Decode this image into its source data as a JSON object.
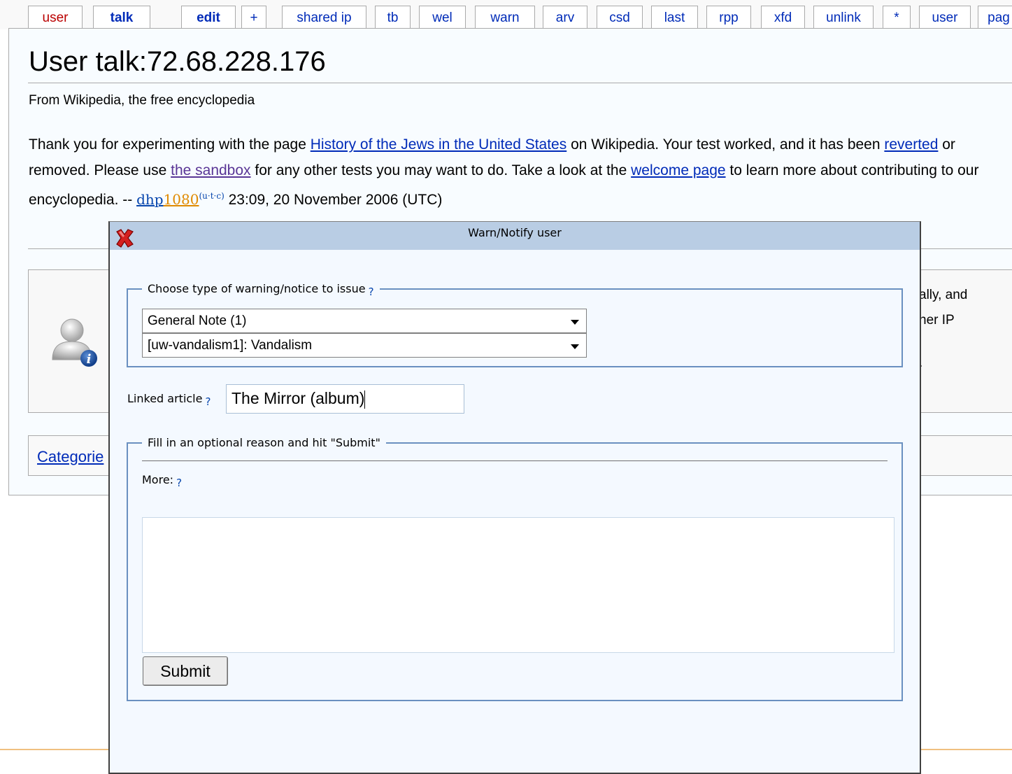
{
  "tabs": [
    {
      "label": "user",
      "style": "red"
    },
    {
      "label": "talk",
      "style": "active"
    },
    {
      "label": "edit",
      "style": "bold"
    },
    {
      "label": "+",
      "style": "normal"
    },
    {
      "label": "shared ip",
      "style": "normal"
    },
    {
      "label": "tb",
      "style": "normal"
    },
    {
      "label": "wel",
      "style": "normal"
    },
    {
      "label": "warn",
      "style": "normal"
    },
    {
      "label": "arv",
      "style": "normal"
    },
    {
      "label": "csd",
      "style": "normal"
    },
    {
      "label": "last",
      "style": "normal"
    },
    {
      "label": "rpp",
      "style": "normal"
    },
    {
      "label": "xfd",
      "style": "normal"
    },
    {
      "label": "unlink",
      "style": "normal"
    },
    {
      "label": "*",
      "style": "normal"
    },
    {
      "label": "user",
      "style": "normal"
    },
    {
      "label": "pag",
      "style": "normal"
    }
  ],
  "page": {
    "title": "User talk:72.68.228.176",
    "subtitle": "From Wikipedia, the free encyclopedia",
    "para_1": "Thank you for experimenting with the page ",
    "link_history": "History of the Jews in the United States",
    "para_2": " on Wikipedia. Your test worked, and it has been ",
    "link_reverted": "reverted",
    "para_3": " or removed. Please use ",
    "link_sandbox": "the sandbox",
    "para_4": " for any other tests you may want to do. Take a look at the ",
    "link_welcome": "welcome page",
    "para_5": " to learn more about contributing to our encyclopedia. -- ",
    "sig_a": "dhp",
    "sig_b": "1080",
    "sig_sup": "(u·t·c)",
    "timestamp": " 23:09, 20 November 2006 (UTC)",
    "notice_line_1": "ally, and",
    "notice_line_2": "her IP",
    "notice_line_3": ".",
    "categories_label": "Categorie"
  },
  "dialog": {
    "title": "Warn/Notify user",
    "close_icon": "close-x-icon",
    "warning_legend": "Choose type of warning/notice to issue",
    "help_mark": "?",
    "warning_level": "General Note (1)",
    "warning_template": "[uw-vandalism1]: Vandalism",
    "linked_article_label": "Linked article",
    "linked_article_value": "The Mirror (album)",
    "reason_legend": "Fill in an optional reason and hit \"Submit\"",
    "more_label": "More:",
    "reason_value": "",
    "submit_label": "Submit"
  },
  "colors": {
    "link": "#002bb8",
    "visited_link": "#5a3696",
    "dialog_titlebar": "#b9cde4",
    "fieldset_border": "#6a90c0"
  }
}
